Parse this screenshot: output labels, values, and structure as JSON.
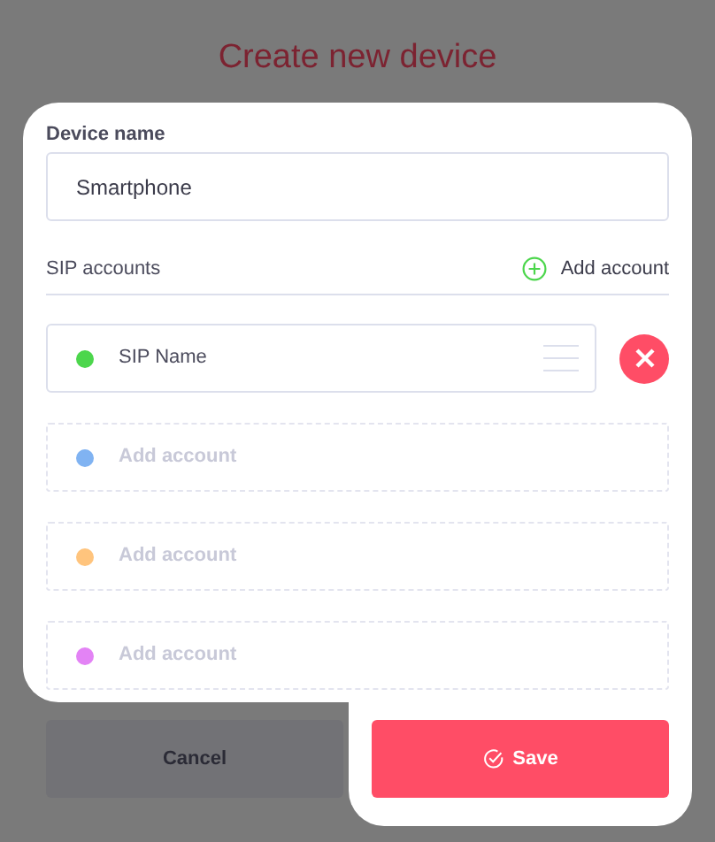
{
  "title": "Create new device",
  "device_name": {
    "label": "Device name",
    "value": "Smartphone"
  },
  "sip_accounts": {
    "label": "SIP accounts",
    "add_button": "Add account",
    "accounts": [
      {
        "kind": "account",
        "name": "SIP Name",
        "color": "#4cd64c"
      },
      {
        "kind": "empty",
        "label": "Add account",
        "color": "#80b3f2"
      },
      {
        "kind": "empty",
        "label": "Add account",
        "color": "#ffc47d"
      },
      {
        "kind": "empty",
        "label": "Add account",
        "color": "#e383f5"
      }
    ]
  },
  "buttons": {
    "cancel": "Cancel",
    "save": "Save"
  }
}
